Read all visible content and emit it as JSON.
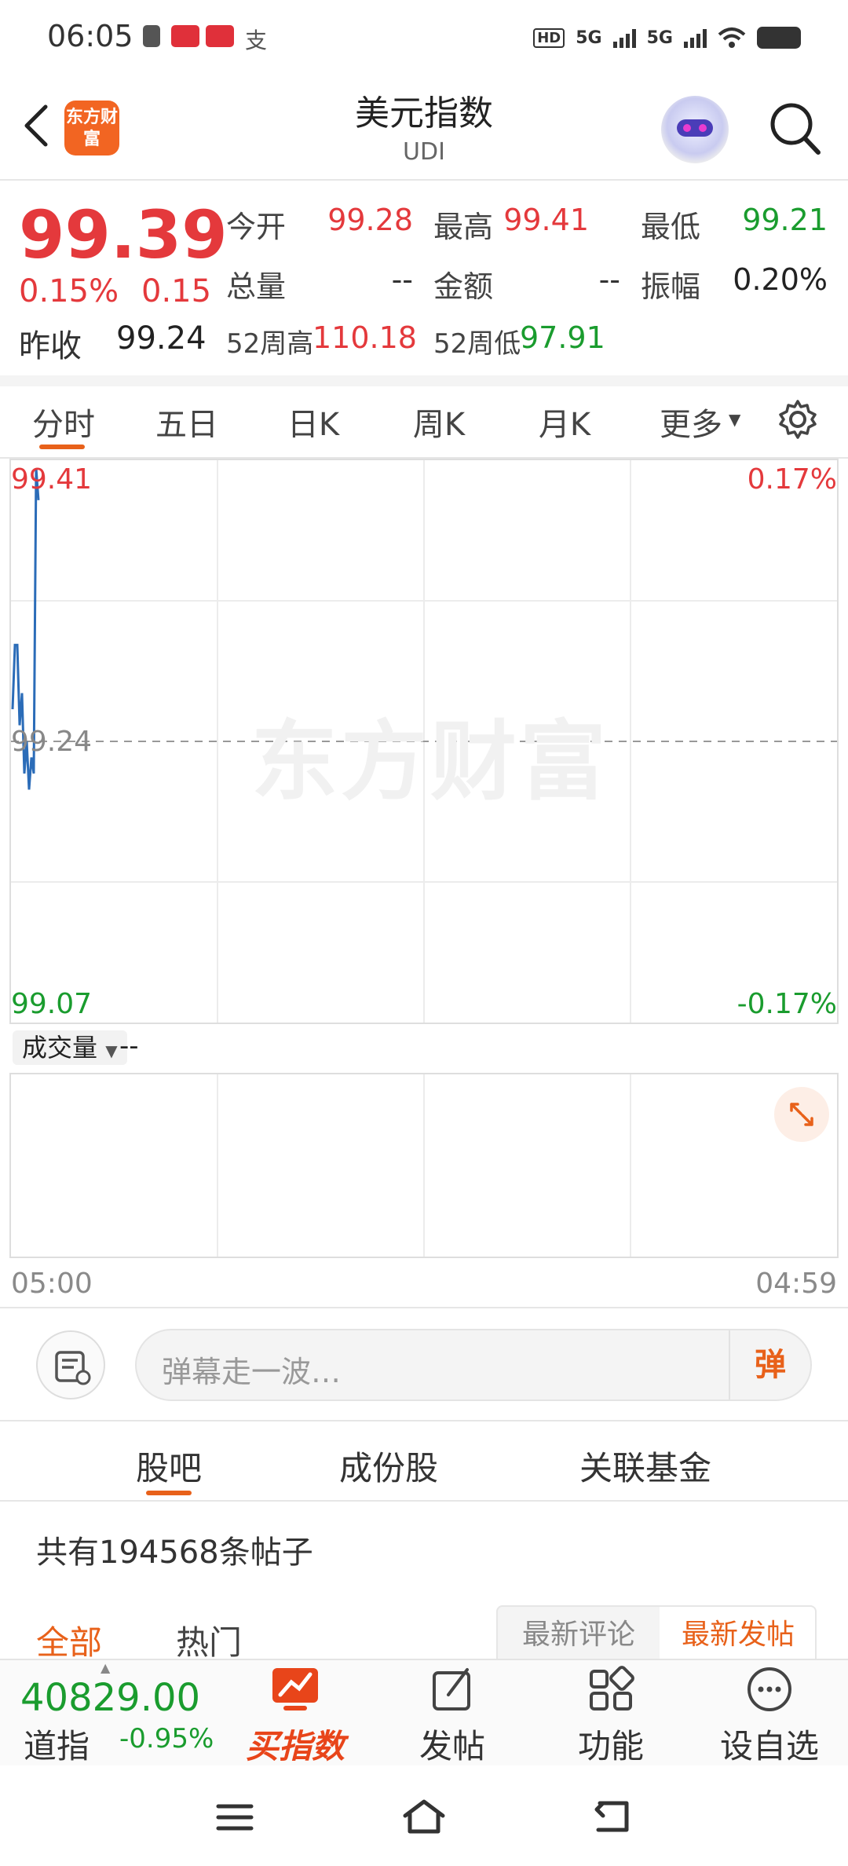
{
  "status_bar": {
    "time": "06:05",
    "net1": "5G",
    "net2": "5G",
    "hd": "HD"
  },
  "header": {
    "logo": "东方财富",
    "title": "美元指数",
    "code": "UDI"
  },
  "quote": {
    "price": "99.39",
    "change_pct": "0.15%",
    "change": "0.15",
    "prev_close_label": "昨收",
    "prev_close": "99.24",
    "open_label": "今开",
    "open": "99.28",
    "high_label": "最高",
    "high": "99.41",
    "low_label": "最低",
    "low": "99.21",
    "volume_label": "总量",
    "volume": "--",
    "amount_label": "金额",
    "amount": "--",
    "amplitude_label": "振幅",
    "amplitude": "0.20%",
    "high52_label": "52周高",
    "high52": "110.18",
    "low52_label": "52周低",
    "low52": "97.91"
  },
  "period_tabs": [
    "分时",
    "五日",
    "日K",
    "周K",
    "月K",
    "更多"
  ],
  "active_period_tab": "分时",
  "chart": {
    "y_top": "99.41",
    "y_mid": "99.24",
    "y_bottom": "99.07",
    "pct_top": "0.17%",
    "pct_bottom": "-0.17%",
    "x_start": "05:00",
    "x_end": "04:59",
    "watermark": "东方财富",
    "volume_selector": "成交量",
    "volume_value": "--"
  },
  "chart_data": {
    "type": "line",
    "ylim": [
      99.07,
      99.41
    ],
    "baseline": 99.24,
    "series": [
      {
        "values": [
          99.26,
          99.3,
          99.3,
          99.25,
          99.27,
          99.22,
          99.24,
          99.21,
          99.23,
          99.22,
          99.41,
          99.39
        ]
      }
    ]
  },
  "danmu": {
    "placeholder": "弹幕走一波…",
    "button": "弹"
  },
  "content_tabs": [
    "股吧",
    "成份股",
    "关联基金"
  ],
  "active_content_tab": "股吧",
  "post_count": "共有194568条帖子",
  "filter": {
    "all": "全部",
    "hot": "热门",
    "sort_comment": "最新评论",
    "sort_post": "最新发帖"
  },
  "bottom_nav": {
    "index_value": "40829.00",
    "index_name": "道指",
    "index_pct": "-0.95%",
    "buy": "买指数",
    "post": "发帖",
    "func": "功能",
    "watch": "设自选"
  },
  "colors": {
    "up": "#e4393c",
    "down": "#1a9c2e",
    "accent": "#e8611a",
    "line": "#2b6cb8"
  }
}
